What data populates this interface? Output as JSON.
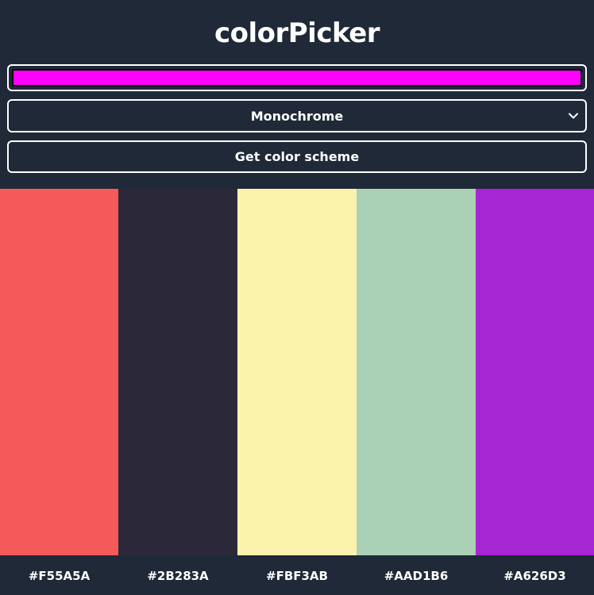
{
  "app": {
    "title": "colorPicker"
  },
  "controls": {
    "seed_color": "#FF00FF",
    "mode_selected": "Monochrome",
    "get_button_label": "Get color scheme"
  },
  "scheme": {
    "colors": [
      {
        "hex": "#F55A5A"
      },
      {
        "hex": "#2B283A"
      },
      {
        "hex": "#FBF3AB"
      },
      {
        "hex": "#AAD1B6"
      },
      {
        "hex": "#A626D3"
      }
    ]
  },
  "icons": {
    "select_chevron": "chevron-down-icon"
  }
}
